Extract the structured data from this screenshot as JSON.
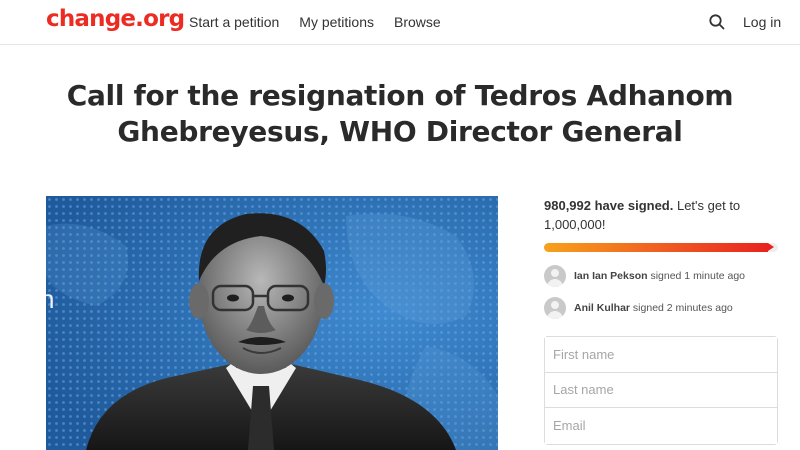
{
  "header": {
    "logo": "change.org",
    "nav": [
      "Start a petition",
      "My petitions",
      "Browse"
    ],
    "search_icon": "search-icon",
    "login": "Log in"
  },
  "petition": {
    "title": "Call for the resignation of Tedros Adhanom Ghebreyesus, WHO Director General",
    "image_partial_text": "n"
  },
  "signatures": {
    "count_text": "980,992 have signed.",
    "goal_text": " Let's get to 1,000,000!",
    "count": 980992,
    "goal": 1000000,
    "progress_fraction": 0.981
  },
  "recent_signers": [
    {
      "name": "Ian Ian Pekson",
      "action": " signed 1 minute ago"
    },
    {
      "name": "Anil Kulhar",
      "action": " signed 2 minutes ago"
    }
  ],
  "form": {
    "first_name_placeholder": "First name",
    "last_name_placeholder": "Last name",
    "email_placeholder": "Email"
  },
  "colors": {
    "brand": "#ec2c22",
    "progress_start": "#f7a21b",
    "progress_end": "#e8231f",
    "image_background": "#2f6fb3"
  }
}
